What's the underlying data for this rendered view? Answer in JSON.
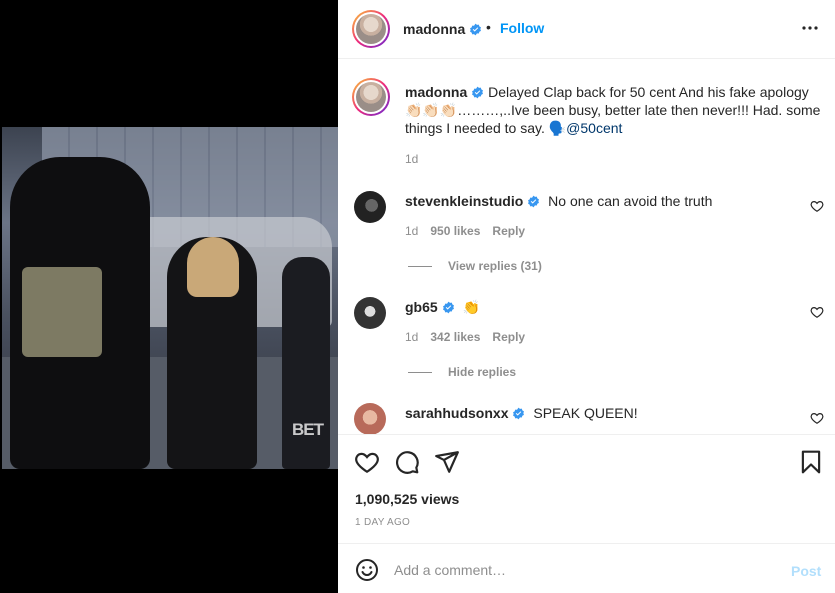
{
  "header": {
    "username": "madonna",
    "separator": "•",
    "follow_label": "Follow",
    "more_icon": "more-horizontal-icon"
  },
  "caption": {
    "username": "madonna",
    "text": "Delayed Clap back for 50 cent And his fake apology 👏🏻👏🏻👏🏻………,..Ive been busy, better late then never!!! Had. some things I needed to say. 🗣️",
    "mention": "@50cent",
    "age": "1d"
  },
  "comments": [
    {
      "username": "stevenkleinstudio",
      "text": "No one can avoid the truth",
      "age": "1d",
      "likes": "950 likes",
      "reply": "Reply",
      "replies_label": "View replies (31)"
    },
    {
      "username": "gb65",
      "text": "👏",
      "age": "1d",
      "likes": "342 likes",
      "reply": "Reply",
      "replies_label": "Hide replies"
    },
    {
      "username": "sarahhudsonxx",
      "text": "SPEAK QUEEN!"
    }
  ],
  "actions": {
    "views": "1,090,525 views",
    "date": "1 DAY AGO"
  },
  "add_comment": {
    "placeholder": "Add a comment…",
    "post_label": "Post"
  },
  "media": {
    "watermark": "BET"
  },
  "colors": {
    "accent": "#0095f6",
    "verified": "#3897f0",
    "muted": "#8e8e8e",
    "post_disabled": "#b2dffc"
  }
}
